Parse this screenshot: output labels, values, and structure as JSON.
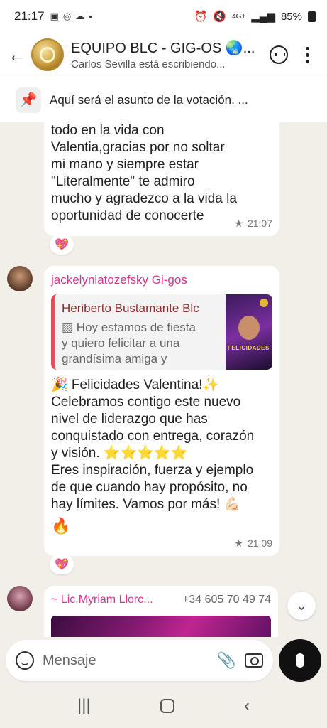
{
  "status": {
    "time": "21:17",
    "network": "4G+",
    "battery": "85%"
  },
  "header": {
    "title": "EQUIPO BLC - GIG-OS 🌏...",
    "subtitle": "Carlos Sevilla está escribiendo..."
  },
  "pinned": {
    "text": "Aquí será el asunto de la votación. ..."
  },
  "messages": [
    {
      "body": "todo en la vida con\nValentia,gracias por no soltar\nmi mano y siempre estar\n\"Literalmente\" te admiro\nmucho y agradezco a la vida la\noportunidad de conocerte",
      "time": "21:07",
      "reaction": "💖"
    },
    {
      "sender": "jackelynlatozefsky Gi-gos",
      "quote_author": "Heriberto Bustamante Blc",
      "quote_text": "Hoy estamos de fiesta\ny quiero felicitar a una\ngrandísima amiga y herman...",
      "quote_thumb_label": "FELICIDADES",
      "body": "🎉 Felicidades Valentina!✨\nCelebramos contigo este nuevo\nnivel de liderazgo que has\nconquistado con entrega, corazón\ny visión. ⭐⭐⭐⭐⭐\nEres inspiración, fuerza y ejemplo\nde que cuando hay propósito, no\nhay límites. Vamos por más! 💪🏻",
      "extra": "🔥",
      "time": "21:09",
      "reaction": "💖"
    },
    {
      "sender": "~ Lic.Myriam Llorc...",
      "phone": "+34 605 70 49 74"
    }
  ],
  "input": {
    "placeholder": "Mensaje"
  },
  "colors": {
    "sender": "#d6338f",
    "chat_bg": "#f2efe9",
    "bubble": "#ffffff",
    "quote_bar": "#e0505a"
  }
}
